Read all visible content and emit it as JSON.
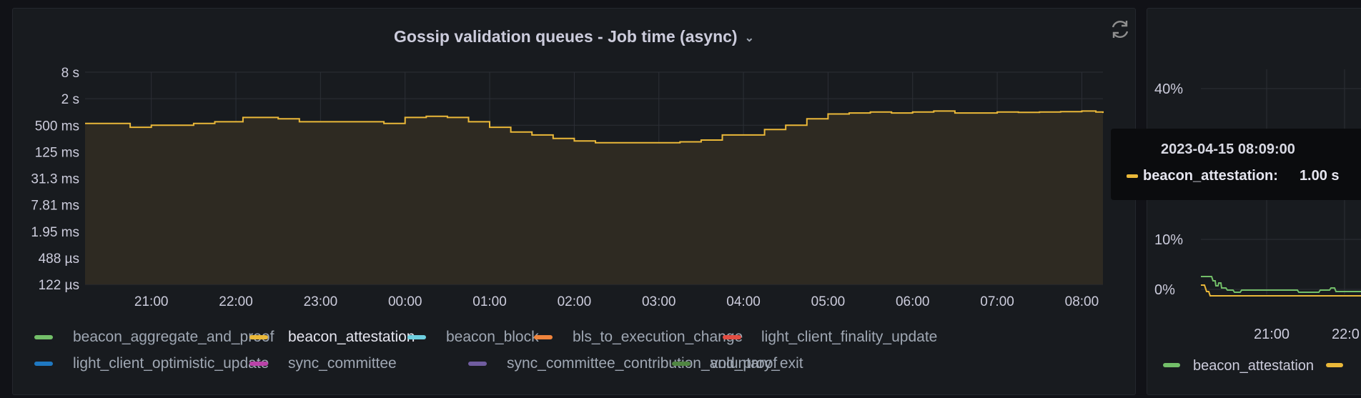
{
  "panel": {
    "title": "Gossip validation queues - Job time (async)",
    "chevron": "⌄"
  },
  "colors": {
    "background": "#111217",
    "panel": "#181b1f",
    "grid": "#2c2f36",
    "attestation": "#eab839",
    "fill": "#2e2a22"
  },
  "chart_data": {
    "type": "line",
    "title": "Gossip validation queues - Job time (async)",
    "y_scale": "log2",
    "y_ticks": [
      {
        "label": "8 s",
        "value": 8
      },
      {
        "label": "2 s",
        "value": 2
      },
      {
        "label": "500 ms",
        "value": 0.5
      },
      {
        "label": "125 ms",
        "value": 0.125
      },
      {
        "label": "31.3 ms",
        "value": 0.03125
      },
      {
        "label": "7.81 ms",
        "value": 0.0078125
      },
      {
        "label": "1.95 ms",
        "value": 0.001953125
      },
      {
        "label": "488 µs",
        "value": 0.00048828125
      },
      {
        "label": "122 µs",
        "value": 0.0001220703125
      }
    ],
    "x_ticks": [
      "21:00",
      "22:00",
      "23:00",
      "00:00",
      "01:00",
      "02:00",
      "03:00",
      "04:00",
      "05:00",
      "06:00",
      "07:00",
      "08:00"
    ],
    "x_range": [
      "20:13",
      "08:15"
    ],
    "legend_position": "bottom",
    "grid": true,
    "series": [
      {
        "name": "beacon_attestation",
        "color": "#eab839",
        "x": [
          "20:13",
          "20:30",
          "20:45",
          "21:00",
          "21:15",
          "21:30",
          "21:45",
          "22:00",
          "22:05",
          "22:30",
          "22:45",
          "23:00",
          "23:30",
          "23:45",
          "00:00",
          "00:15",
          "00:30",
          "00:45",
          "01:00",
          "01:15",
          "01:30",
          "01:45",
          "02:00",
          "02:15",
          "02:30",
          "02:45",
          "03:00",
          "03:15",
          "03:30",
          "03:45",
          "04:00",
          "04:15",
          "04:30",
          "04:45",
          "05:00",
          "05:15",
          "05:30",
          "05:45",
          "06:00",
          "06:15",
          "06:30",
          "06:45",
          "07:00",
          "07:15",
          "07:30",
          "07:45",
          "08:00",
          "08:10",
          "08:15"
        ],
        "y": [
          0.55,
          0.55,
          0.45,
          0.5,
          0.5,
          0.55,
          0.6,
          0.6,
          0.75,
          0.7,
          0.6,
          0.6,
          0.6,
          0.55,
          0.75,
          0.8,
          0.75,
          0.6,
          0.45,
          0.35,
          0.3,
          0.25,
          0.22,
          0.2,
          0.2,
          0.2,
          0.2,
          0.21,
          0.23,
          0.3,
          0.3,
          0.4,
          0.5,
          0.7,
          0.9,
          0.95,
          1.0,
          0.95,
          1.0,
          1.05,
          0.95,
          0.95,
          1.0,
          0.98,
          1.0,
          1.02,
          1.05,
          1.0,
          0.95
        ]
      }
    ]
  },
  "legend": [
    {
      "label": "beacon_aggregate_and_proof",
      "color": "#73bf69",
      "active": false
    },
    {
      "label": "beacon_attestation",
      "color": "#eab839",
      "active": true
    },
    {
      "label": "beacon_block",
      "color": "#6ed0e0",
      "active": false
    },
    {
      "label": "bls_to_execution_change",
      "color": "#ef843c",
      "active": false
    },
    {
      "label": "light_client_finality_update",
      "color": "#e24d42",
      "active": false
    },
    {
      "label": "light_client_optimistic_update",
      "color": "#1f78c1",
      "active": false
    },
    {
      "label": "sync_committee",
      "color": "#ba43a9",
      "active": false
    },
    {
      "label": "sync_committee_contribution_and_proof",
      "color": "#705da0",
      "active": false
    },
    {
      "label": "voluntary_exit",
      "color": "#508642",
      "active": false
    }
  ],
  "tooltip": {
    "time": "2023-04-15 08:09:00",
    "series": "beacon_attestation:",
    "value": "1.00 s",
    "color": "#eab839"
  },
  "panel2": {
    "y_ticks": [
      "40%",
      "10%",
      "0%"
    ],
    "x_ticks": [
      "21:00",
      "22:0"
    ],
    "legend": [
      {
        "label": "beacon_attestation",
        "color": "#73bf69"
      },
      {
        "label": "",
        "color": "#eab839"
      }
    ]
  }
}
